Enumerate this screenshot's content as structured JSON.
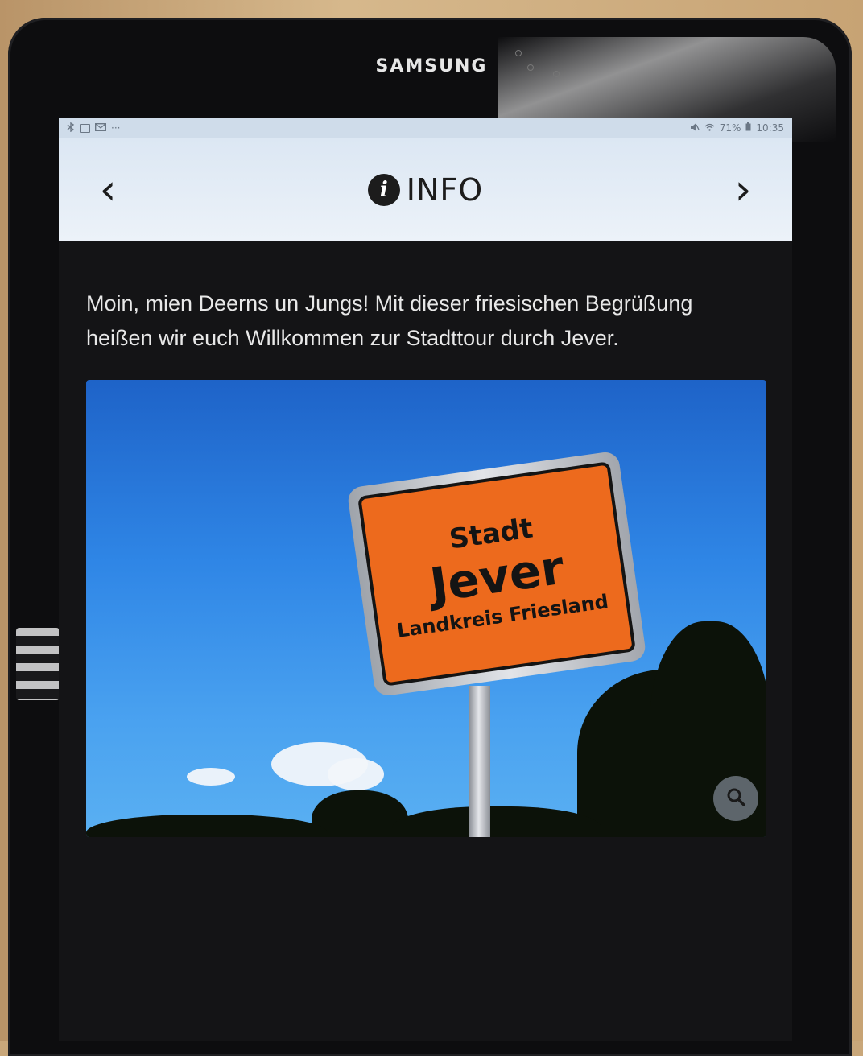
{
  "device": {
    "brand": "SAMSUNG"
  },
  "statusbar": {
    "left_icons": [
      "bluetooth-icon",
      "screenshot-icon",
      "mail-icon",
      "more-icon"
    ],
    "more_text": "···",
    "battery": "71%",
    "time": "10:35",
    "right_icons": [
      "mute-icon",
      "wifi-icon",
      "battery-icon"
    ]
  },
  "header": {
    "title": "INFO",
    "info_glyph": "i",
    "prev_glyph": "‹",
    "next_glyph": "›"
  },
  "content": {
    "intro_text": "Moin, mien Deerns un Jungs! Mit dieser friesischen Begrüßung heißen wir euch Willkommen zur Stadttour durch Jever."
  },
  "photo": {
    "sign_line1": "Stadt",
    "sign_line2": "Jever",
    "sign_line3": "Landkreis Friesland",
    "zoom_icon": "magnifier-icon"
  },
  "colors": {
    "header_bg": "#e3ecf6",
    "screen_bg": "#141416",
    "sign_orange": "#ed6a1d",
    "sky_blue": "#2f86e6"
  }
}
